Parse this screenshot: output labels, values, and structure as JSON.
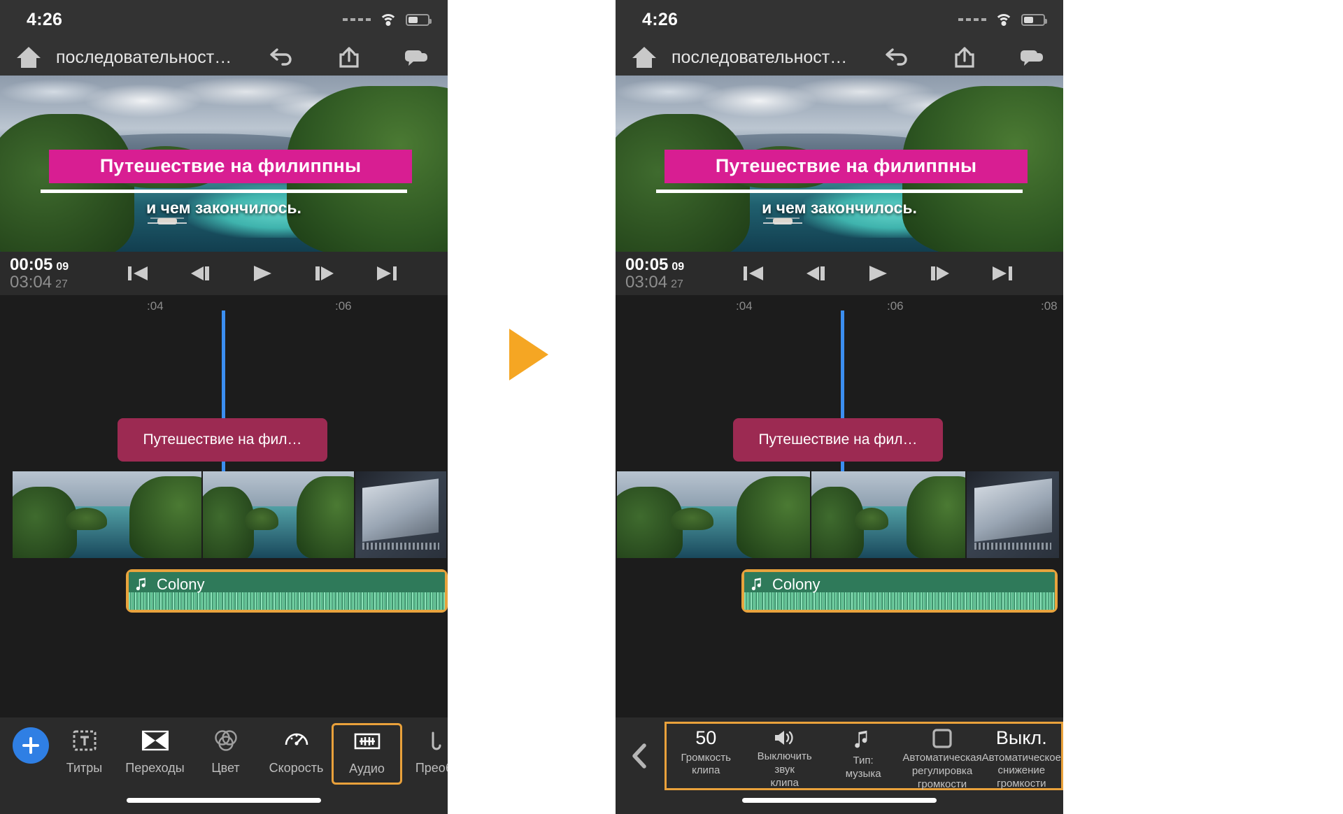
{
  "status_bar": {
    "time": "4:26",
    "wifi_icon": "wifi-icon",
    "battery_icon": "battery-icon",
    "signal_icon": "signal-dots-icon"
  },
  "app_toolbar": {
    "home_icon": "home-icon",
    "project_title": "последовательност…",
    "undo_icon": "undo-icon",
    "share_icon": "share-icon",
    "comment_icon": "comment-icon"
  },
  "preview": {
    "title_text": "Путешествие на филиппны",
    "subtitle_text": "и чем закончилось.",
    "title_bg_color": "#d81e92"
  },
  "transport": {
    "current_time": "00:05",
    "current_frames": "09",
    "total_time": "03:04",
    "total_frames": "27",
    "buttons": [
      {
        "name": "skip-to-start-button",
        "label": "skip-start-icon"
      },
      {
        "name": "step-back-button",
        "label": "step-back-icon"
      },
      {
        "name": "play-button",
        "label": "play-icon"
      },
      {
        "name": "step-forward-button",
        "label": "step-forward-icon"
      },
      {
        "name": "skip-to-end-button",
        "label": "skip-end-icon"
      }
    ]
  },
  "timeline": {
    "ruler_ticks": [
      ":04",
      ":06",
      ":08"
    ],
    "playhead_color": "#3b8ef0",
    "title_clip_label": "Путешествие на фил…",
    "audio_clip_label": "Colony",
    "audio_clip_icon": "music-note-icon",
    "audio_clip_color": "#e8a33d",
    "title_clip_color": "#9c2a52"
  },
  "bottom_tabs": {
    "add_button": "add-button",
    "items": [
      {
        "label": "Титры",
        "icon": "titles-icon",
        "selected": false
      },
      {
        "label": "Переходы",
        "icon": "transitions-icon",
        "selected": false
      },
      {
        "label": "Цвет",
        "icon": "color-icon",
        "selected": false
      },
      {
        "label": "Скорость",
        "icon": "speed-icon",
        "selected": false
      },
      {
        "label": "Аудио",
        "icon": "audio-icon",
        "selected": true
      },
      {
        "label": "Преобр",
        "icon": "transform-icon",
        "selected": false
      }
    ],
    "selected_outline_color": "#e9a13b"
  },
  "audio_options": {
    "back_icon": "chevron-left-icon",
    "outline_color": "#e9a13b",
    "items": [
      {
        "value": "50",
        "icon": "",
        "label": "Громкость\nклипа"
      },
      {
        "value": "",
        "icon": "speaker-icon",
        "label": "Выключить\nзвук\nклипа"
      },
      {
        "value": "",
        "icon": "music-note-icon",
        "label": "Тип:\nмузыка"
      },
      {
        "value": "",
        "icon": "square-icon",
        "label": "Автоматическая\nрегулировка\nгромкости"
      },
      {
        "value": "Выкл.",
        "icon": "",
        "label": "Автоматическое\nснижение\nгромкости"
      }
    ]
  },
  "transition_arrow": {
    "name": "step-arrow",
    "color": "#f5a623"
  }
}
